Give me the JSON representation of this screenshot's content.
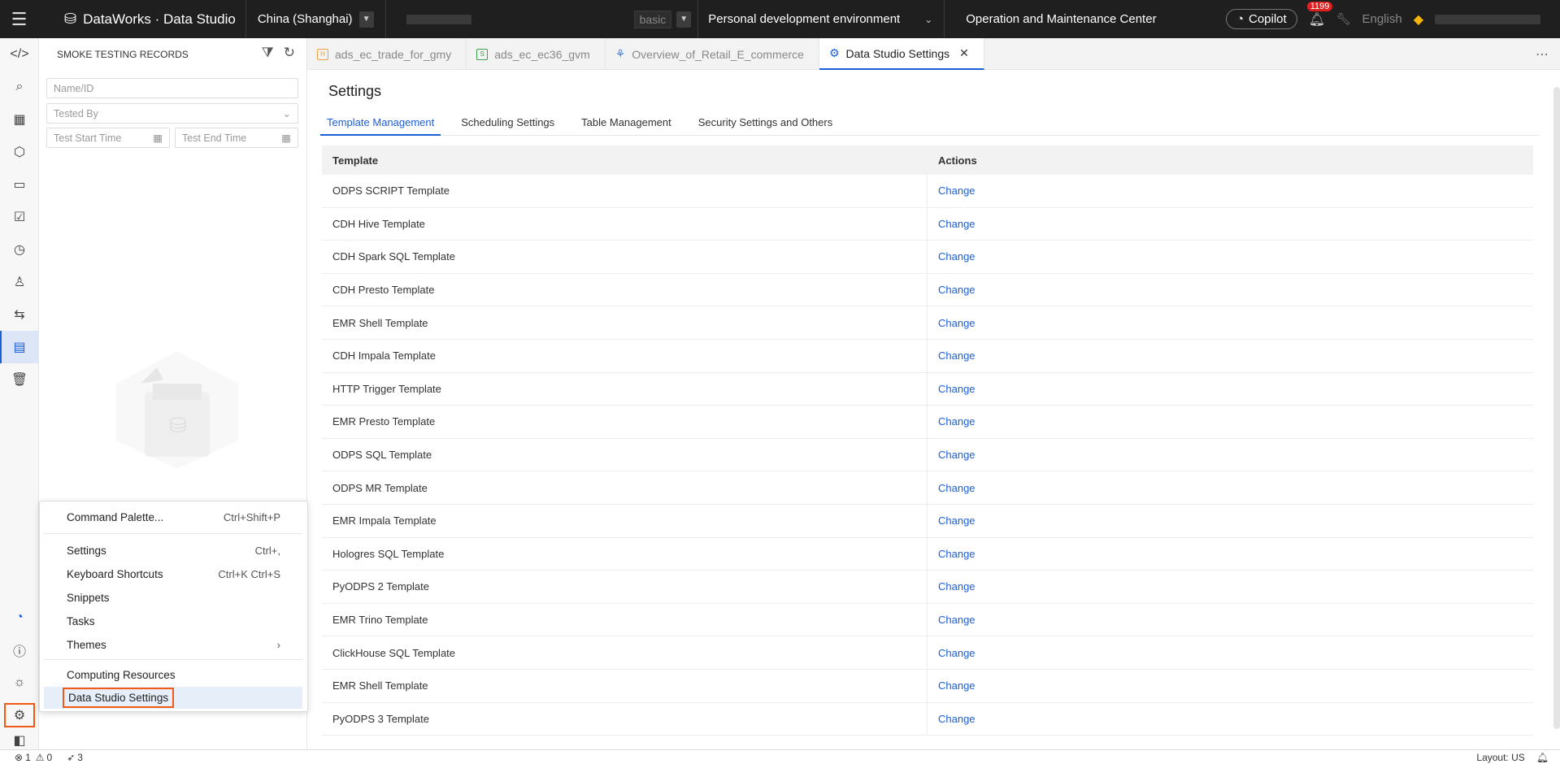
{
  "topbar": {
    "product": "DataWorks · Data Studio",
    "region": "China (Shanghai)",
    "version": "basic",
    "environment": "Personal development environment",
    "ops_center": "Operation and Maintenance Center",
    "copilot": "Copilot",
    "notifications": "1199",
    "language": "English"
  },
  "sidebar": {
    "title": "SMOKE TESTING RECORDS",
    "name_placeholder": "Name/ID",
    "tested_by_placeholder": "Tested By",
    "start_placeholder": "Test Start Time",
    "end_placeholder": "Test End Time"
  },
  "tabs": [
    {
      "label": "ads_ec_trade_for_gmy",
      "icon": "holo-icon"
    },
    {
      "label": "ads_ec_ec36_gvm",
      "icon": "sql-icon"
    },
    {
      "label": "Overview_of_Retail_E_commerce",
      "icon": "workflow-icon"
    },
    {
      "label": "Data Studio Settings",
      "icon": "gear-icon"
    }
  ],
  "settings": {
    "title": "Settings",
    "subtabs": [
      "Template Management",
      "Scheduling Settings",
      "Table Management",
      "Security Settings and Others"
    ],
    "col_template": "Template",
    "col_actions": "Actions",
    "action_label": "Change",
    "rows": [
      "ODPS SCRIPT Template",
      "CDH Hive Template",
      "CDH Spark SQL Template",
      "CDH Presto Template",
      "EMR Shell Template",
      "CDH Impala Template",
      "HTTP Trigger Template",
      "EMR Presto Template",
      "ODPS SQL Template",
      "ODPS MR Template",
      "EMR Impala Template",
      "Hologres SQL Template",
      "PyODPS 2 Template",
      "EMR Trino Template",
      "ClickHouse SQL Template",
      "EMR Shell Template",
      "PyODPS 3 Template"
    ]
  },
  "menu": {
    "command_palette": "Command Palette...",
    "command_palette_sc": "Ctrl+Shift+P",
    "settings": "Settings",
    "settings_sc": "Ctrl+,",
    "keyboard": "Keyboard Shortcuts",
    "keyboard_sc": "Ctrl+K Ctrl+S",
    "snippets": "Snippets",
    "tasks": "Tasks",
    "themes": "Themes",
    "computing": "Computing Resources",
    "ds_settings": "Data Studio Settings"
  },
  "status": {
    "errors": "1",
    "warnings": "0",
    "sends": "3",
    "layout": "Layout: US"
  }
}
